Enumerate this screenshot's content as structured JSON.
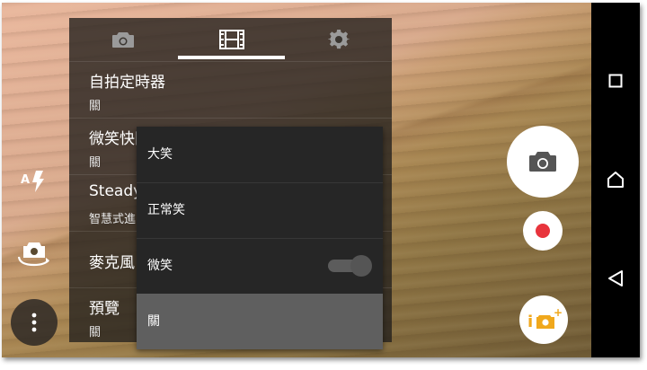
{
  "settings_panel": {
    "tabs": [
      {
        "icon": "camera-icon"
      },
      {
        "icon": "film-icon",
        "active": true
      },
      {
        "icon": "gear-icon"
      }
    ],
    "items": [
      {
        "title": "自拍定時器",
        "value": "關"
      },
      {
        "title": "微笑快門(影片)",
        "value": "關"
      },
      {
        "title": "SteadyShot™",
        "value": "智慧式進階"
      },
      {
        "title": "麥克風",
        "value": ""
      },
      {
        "title": "預覽",
        "value": "關"
      }
    ]
  },
  "smile_menu": {
    "options": [
      {
        "label": "大笑",
        "selected": false
      },
      {
        "label": "正常笑",
        "selected": false
      },
      {
        "label": "微笑",
        "selected": false
      },
      {
        "label": "關",
        "selected": true
      }
    ]
  },
  "left_controls": {
    "auto_flash_label": "A",
    "icons": [
      "auto-flash-icon",
      "switch-camera-icon",
      "more-options-icon"
    ]
  },
  "right_controls": {
    "icons": [
      "shutter-camera-icon",
      "record-icon",
      "smart-photo-icon"
    ],
    "smart_label": "i",
    "smart_plus": "+",
    "record_color": "#e8343c",
    "smart_color": "#f0a81c"
  },
  "nav_bar": {
    "icons": [
      "recents-icon",
      "home-icon",
      "back-icon"
    ]
  }
}
